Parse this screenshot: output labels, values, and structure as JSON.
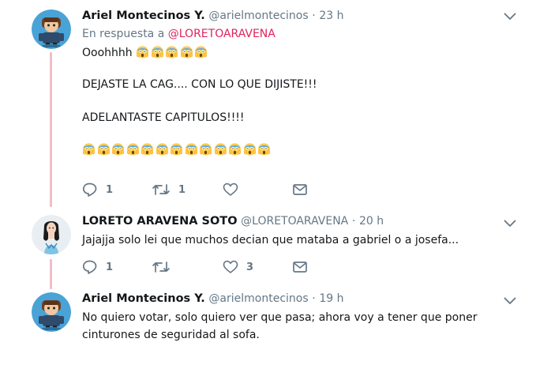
{
  "tweets": [
    {
      "name": "Ariel Montecinos Y.",
      "handle": "@arielmontecinos",
      "separator": "·",
      "time": "23 h",
      "reply_prefix": "En respuesta a",
      "reply_mention": "@LORETOARAVENA",
      "lines": [
        "Ooohhhh",
        "DEJASTE LA CAG.... CON LO QUE DIJISTE!!!",
        "ADELANTASTE CAPITULOS!!!!"
      ],
      "emoji_after_first_line": 5,
      "emoji_final_line": 13,
      "emoji_name": "face-screaming-in-fear",
      "actions": {
        "reply_count": "1",
        "retweet_count": "1",
        "like_count": "",
        "dm_count": ""
      }
    },
    {
      "name": "LORETO ARAVENA SOTO",
      "handle": "@LORETOARAVENA",
      "separator": "·",
      "time": "20 h",
      "lines": [
        "Jajajja solo lei que muchos decian que mataba a gabriel o a josefa..."
      ],
      "actions": {
        "reply_count": "1",
        "retweet_count": "",
        "like_count": "3",
        "dm_count": ""
      }
    },
    {
      "name": "Ariel Montecinos Y.",
      "handle": "@arielmontecinos",
      "separator": "·",
      "time": "19 h",
      "lines": [
        "No quiero votar, solo quiero ver que pasa; ahora voy a tener que poner",
        "cinturones de seguridad al sofa."
      ]
    }
  ],
  "colors": {
    "thread_line": "#f0bfc9",
    "mention": "#e0245e",
    "secondary_text": "#657786",
    "primary_text": "#14171a",
    "avatar_bg": "#4aa3d6"
  },
  "icons": [
    "reply-icon",
    "retweet-icon",
    "like-icon",
    "direct-message-icon",
    "chevron-down-icon"
  ]
}
